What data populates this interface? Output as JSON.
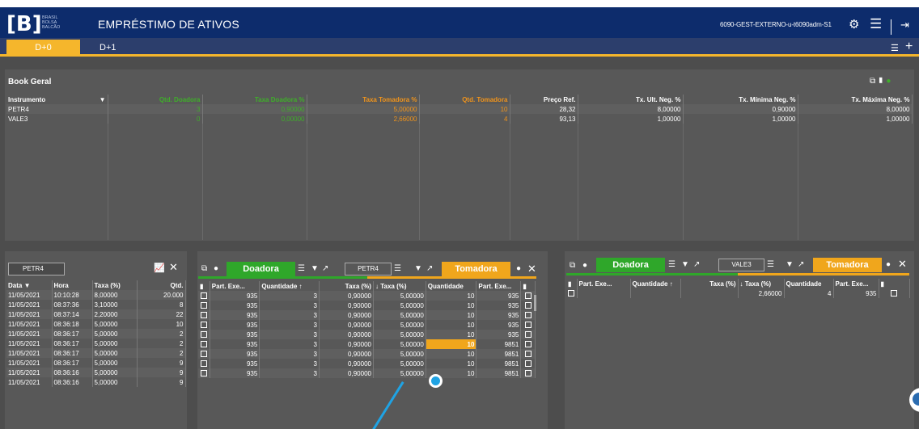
{
  "header": {
    "logo_letter": "[B]",
    "logo_sub": [
      "BRASIL",
      "BOLSA",
      "BALCÃO"
    ],
    "title": "EMPRÉSTIMO DE ATIVOS",
    "user": "6090-GEST-EXTERNO-u-t6090adm-S1"
  },
  "tabs": [
    {
      "label": "D+0",
      "active": true
    },
    {
      "label": "D+1",
      "active": false
    }
  ],
  "book": {
    "title": "Book Geral",
    "columns": [
      "Instrumento",
      "Qtd. Doadora",
      "Taxa Doadora %",
      "Taxa Tomadora %",
      "Qtd. Tomadora",
      "Preço Ref.",
      "Tx. Ult. Neg. %",
      "Tx. Mínima Neg. %",
      "Tx. Máxima Neg. %"
    ],
    "rows": [
      [
        "PETR4",
        "3",
        "0,90000",
        "5,00000",
        "10",
        "28,32",
        "8,00000",
        "0,90000",
        "8,00000"
      ],
      [
        "VALE3",
        "0",
        "0,00000",
        "2,66000",
        "4",
        "93,13",
        "1,00000",
        "1,00000",
        "1,00000"
      ]
    ]
  },
  "trades_panel": {
    "instrument": "PETR4",
    "columns": [
      "Data",
      "Hora",
      "Taxa (%)",
      "Qtd."
    ],
    "rows": [
      [
        "11/05/2021",
        "10:10:28",
        "8,00000",
        "20.000"
      ],
      [
        "11/05/2021",
        "08:37:36",
        "3,10000",
        "8"
      ],
      [
        "11/05/2021",
        "08:37:14",
        "2,20000",
        "22"
      ],
      [
        "11/05/2021",
        "08:36:18",
        "5,00000",
        "10"
      ],
      [
        "11/05/2021",
        "08:36:17",
        "5,00000",
        "2"
      ],
      [
        "11/05/2021",
        "08:36:17",
        "5,00000",
        "2"
      ],
      [
        "11/05/2021",
        "08:36:17",
        "5,00000",
        "2"
      ],
      [
        "11/05/2021",
        "08:36:17",
        "5,00000",
        "9"
      ],
      [
        "11/05/2021",
        "08:36:16",
        "5,00000",
        "9"
      ],
      [
        "11/05/2021",
        "08:36:16",
        "5,00000",
        "9"
      ]
    ]
  },
  "offers_petr4": {
    "donor_label": "Doadora",
    "taker_label": "Tomadora",
    "instrument": "PETR4",
    "columns": [
      "Part. Exe...",
      "Quantidade",
      "Taxa (%)",
      "Taxa (%)",
      "Quantidade",
      "Part. Exe..."
    ],
    "rows": [
      [
        "935",
        "3",
        "0,90000",
        "5,00000",
        "10",
        "935"
      ],
      [
        "935",
        "3",
        "0,90000",
        "5,00000",
        "10",
        "935"
      ],
      [
        "935",
        "3",
        "0,90000",
        "5,00000",
        "10",
        "935"
      ],
      [
        "935",
        "3",
        "0,90000",
        "5,00000",
        "10",
        "935"
      ],
      [
        "935",
        "3",
        "0,90000",
        "5,00000",
        "10",
        "935"
      ],
      [
        "935",
        "3",
        "0,90000",
        "5,00000",
        "10",
        "9851"
      ],
      [
        "935",
        "3",
        "0,90000",
        "5,00000",
        "10",
        "9851"
      ],
      [
        "935",
        "3",
        "0,90000",
        "5,00000",
        "10",
        "9851"
      ],
      [
        "935",
        "3",
        "0,90000",
        "5,00000",
        "10",
        "9851"
      ]
    ]
  },
  "offers_vale3": {
    "donor_label": "Doadora",
    "taker_label": "Tomadora",
    "instrument": "VALE3",
    "columns": [
      "Part. Exe...",
      "Quantidade",
      "Taxa (%)",
      "Taxa (%)",
      "Quantidade",
      "Part. Exe..."
    ],
    "rows": [
      [
        "",
        "",
        "",
        "2,66000",
        "4",
        "935"
      ]
    ]
  }
}
